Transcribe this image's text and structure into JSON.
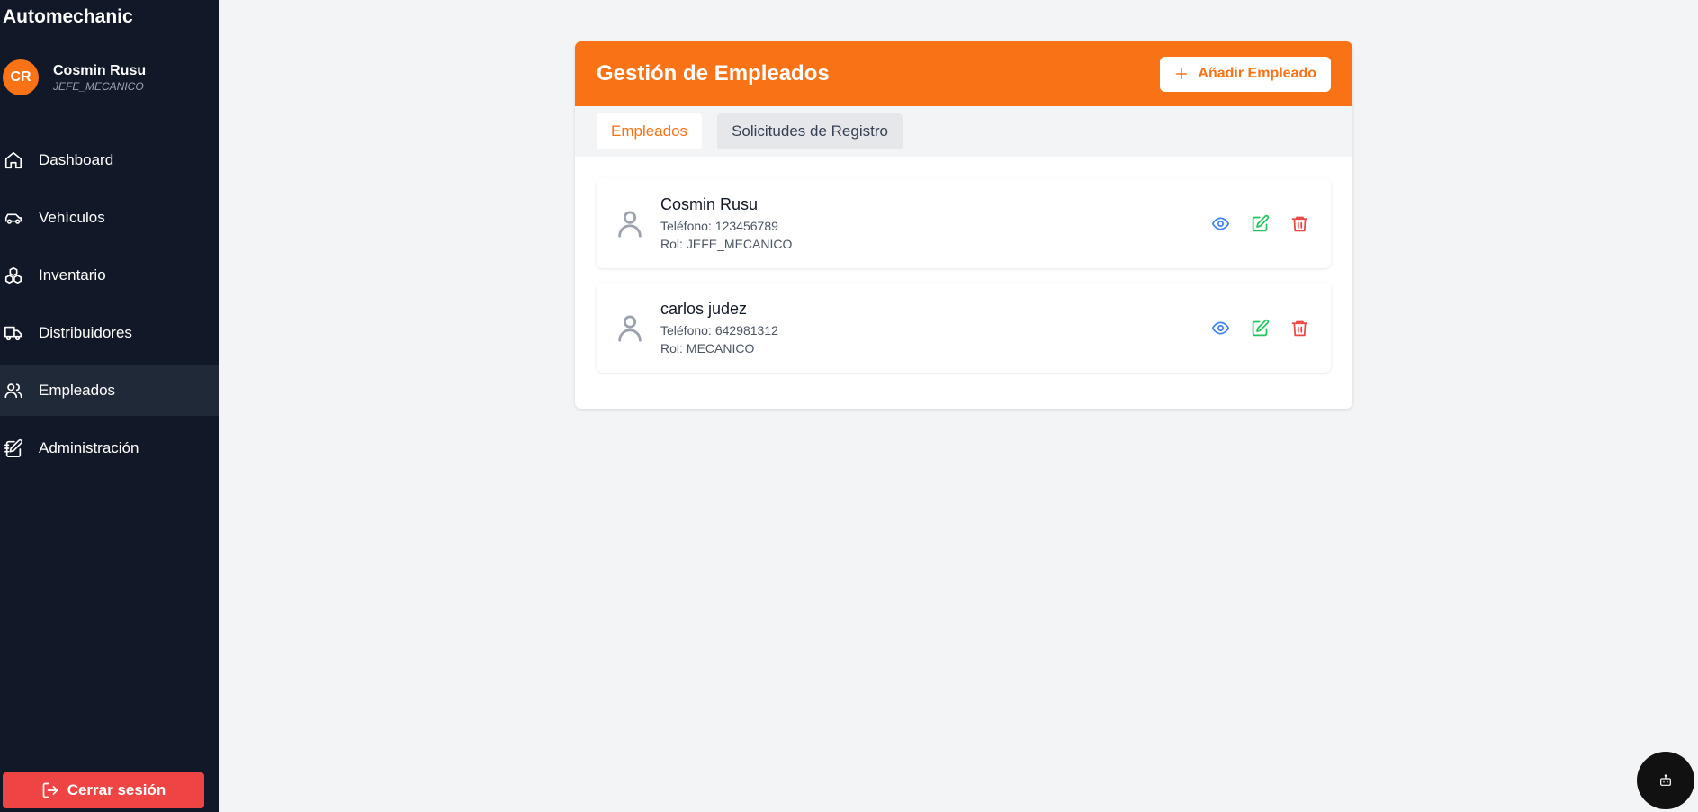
{
  "app": {
    "title": "Automechanic"
  },
  "user": {
    "initials": "CR",
    "name": "Cosmin Rusu",
    "role": "JEFE_MECANICO"
  },
  "sidebar": {
    "items": [
      {
        "label": "Dashboard",
        "icon": "home-icon"
      },
      {
        "label": "Vehículos",
        "icon": "car-icon"
      },
      {
        "label": "Inventario",
        "icon": "boxes-icon"
      },
      {
        "label": "Distribuidores",
        "icon": "truck-icon"
      },
      {
        "label": "Empleados",
        "icon": "users-icon",
        "active": true
      },
      {
        "label": "Administración",
        "icon": "notebook-pen-icon"
      }
    ],
    "logout_label": "Cerrar sesión"
  },
  "page": {
    "title": "Gestión de Empleados",
    "add_button_label": "Añadir Empleado",
    "tabs": [
      {
        "label": "Empleados",
        "active": true
      },
      {
        "label": "Solicitudes de Registro",
        "active": false
      }
    ],
    "employees": [
      {
        "name": "Cosmin Rusu",
        "phone_label": "Teléfono:",
        "phone": "123456789",
        "role_label": "Rol:",
        "role": "JEFE_MECANICO"
      },
      {
        "name": "carlos judez",
        "phone_label": "Teléfono:",
        "phone": "642981312",
        "role_label": "Rol:",
        "role": "MECANICO"
      }
    ]
  },
  "colors": {
    "accent": "#f97316",
    "sidebar_bg": "#111827",
    "danger": "#ef4444",
    "view": "#3b82f6",
    "edit": "#22c55e"
  }
}
